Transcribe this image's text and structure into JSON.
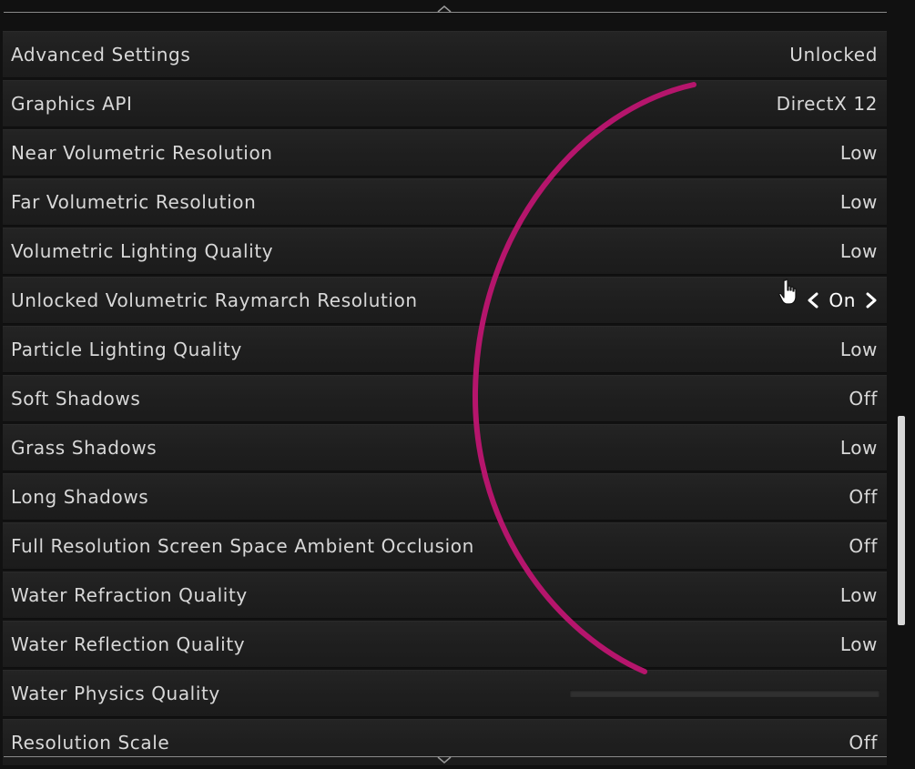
{
  "settings": {
    "rows": [
      {
        "label": "Advanced Settings",
        "value": "Unlocked"
      },
      {
        "label": "Graphics API",
        "value": "DirectX 12"
      },
      {
        "label": "Near Volumetric Resolution",
        "value": "Low"
      },
      {
        "label": "Far Volumetric Resolution",
        "value": "Low"
      },
      {
        "label": "Volumetric Lighting Quality",
        "value": "Low"
      },
      {
        "label": "Unlocked Volumetric Raymarch Resolution",
        "value": "On"
      },
      {
        "label": "Particle Lighting Quality",
        "value": "Low"
      },
      {
        "label": "Soft Shadows",
        "value": "Off"
      },
      {
        "label": "Grass Shadows",
        "value": "Low"
      },
      {
        "label": "Long Shadows",
        "value": "Off"
      },
      {
        "label": "Full Resolution Screen Space Ambient Occlusion",
        "value": "Off"
      },
      {
        "label": "Water Refraction Quality",
        "value": "Low"
      },
      {
        "label": "Water Reflection Quality",
        "value": "Low"
      },
      {
        "label": "Water Physics Quality",
        "slider": 0
      },
      {
        "label": "Resolution Scale",
        "value": "Off"
      }
    ],
    "selected_row": 5
  },
  "icons": {
    "prev": "chevron-left-icon",
    "next": "chevron-right-icon",
    "cursor": "hand-pointer-icon",
    "scroll_up": "caret-up-icon",
    "scroll_down": "caret-down-icon"
  },
  "colors": {
    "text": "#d8d8d8",
    "selected_text": "#ffffff",
    "annotation": "#b5156c",
    "scrollbar": "#d7d7d7"
  }
}
